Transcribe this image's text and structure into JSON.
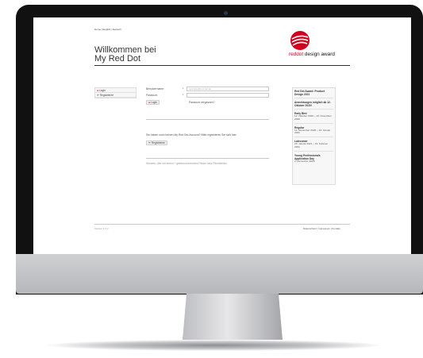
{
  "header": {
    "languages": "Home | English | Deutsch",
    "title_line1": "Willkommen bei",
    "title_line2": "My Red Dot",
    "logo_red": "reddot",
    "logo_rest": " design award"
  },
  "nav": {
    "items": [
      {
        "label": "Login",
        "icon": "person-icon"
      },
      {
        "label": "Registrieren",
        "icon": "pencil-icon"
      }
    ]
  },
  "form": {
    "username_label": "Benutzername:",
    "username_placeholder": "example@red-dot.de",
    "password_label": "Passwort:",
    "required_mark": "*",
    "login_button": "Login",
    "forgot_link": "Passwort vergessen?",
    "no_account_text": "Sie haben noch keinen My Red Dot-Account? Bitte registrieren Sie sich hier:",
    "register_button": "Registrieren",
    "note": "Hinweis: Alle mit einem * gekennzeichneten Felder sind Pflichtfelder."
  },
  "sidebar": {
    "blocks": [
      {
        "heading": "Red Dot Award: Product Design 2021",
        "text": ""
      },
      {
        "heading": "Anmeldungen möglich ab 12. Oktober 2020!",
        "text": ""
      },
      {
        "heading": "Early Bird",
        "text": "12. Oktober 2020 – 13. November 2020"
      },
      {
        "heading": "Regular",
        "text": "14. November 2020 – 22. Januar 2021"
      },
      {
        "heading": "Latecomer",
        "text": "23. Januar 2021 – 19. Februar 2021"
      },
      {
        "heading": "Young Professionals Application Day",
        "text": "2. Dezember 2020"
      }
    ]
  },
  "footer": {
    "version": "Version 2.1.2",
    "links": "Datenschutz | Impressum | Kontakt"
  },
  "colors": {
    "brand_red": "#d2001f",
    "bezel": "#111111",
    "chin": "#c4c5c8"
  }
}
